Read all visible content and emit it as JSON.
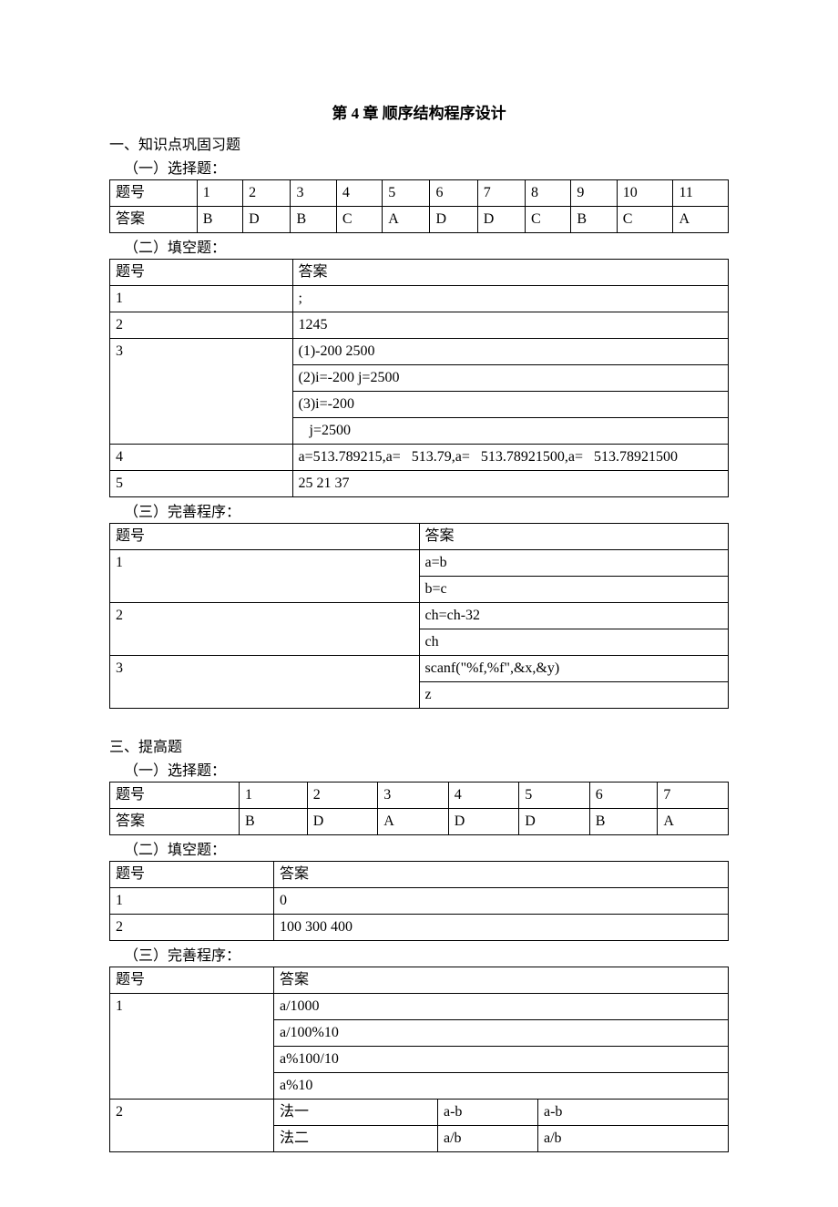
{
  "page_title": "第 4 章  顺序结构程序设计",
  "section1": {
    "heading": "一、知识点巩固习题",
    "sub1": {
      "heading": "（一）选择题：",
      "table": {
        "row_label_1": "题号",
        "row_label_2": "答案",
        "headers": [
          "1",
          "2",
          "3",
          "4",
          "5",
          "6",
          "7",
          "8",
          "9",
          "10",
          "11"
        ],
        "answers": [
          "B",
          "D",
          "B",
          "C",
          "A",
          "D",
          "D",
          "C",
          "B",
          "C",
          "A"
        ]
      }
    },
    "sub2": {
      "heading": "（二）填空题：",
      "table": {
        "h1": "题号",
        "h2": "答案",
        "rows": [
          {
            "num": "1",
            "lines": [
              ";"
            ]
          },
          {
            "num": "2",
            "lines": [
              "1245"
            ]
          },
          {
            "num": "3",
            "lines": [
              "(1)-200 2500",
              "(2)i=-200 j=2500",
              "(3)i=-200",
              "   j=2500"
            ]
          },
          {
            "num": "4",
            "lines": [
              "a=513.789215,a=   513.79,a=   513.78921500,a=   513.78921500"
            ]
          },
          {
            "num": "5",
            "lines": [
              "25 21 37"
            ]
          }
        ]
      }
    },
    "sub3": {
      "heading": "（三）完善程序：",
      "table": {
        "h1": "题号",
        "h2": "答案",
        "rows": [
          {
            "num": "1",
            "lines": [
              "a=b",
              "b=c"
            ]
          },
          {
            "num": "2",
            "lines": [
              "ch=ch-32",
              "ch"
            ]
          },
          {
            "num": "3",
            "lines": [
              "scanf(\"%f,%f\",&x,&y)",
              "z"
            ]
          }
        ]
      }
    }
  },
  "section3": {
    "heading": "三、提高题",
    "sub1": {
      "heading": "（一）选择题：",
      "table": {
        "row_label_1": "题号",
        "row_label_2": "答案",
        "headers": [
          "1",
          "2",
          "3",
          "4",
          "5",
          "6",
          "7"
        ],
        "answers": [
          "B",
          "D",
          "A",
          "D",
          "D",
          "B",
          "A"
        ]
      }
    },
    "sub2": {
      "heading": "（二）填空题：",
      "table": {
        "h1": "题号",
        "h2": "答案",
        "rows": [
          {
            "num": "1",
            "lines": [
              "0"
            ]
          },
          {
            "num": "2",
            "lines": [
              "100 300 400"
            ]
          }
        ]
      }
    },
    "sub3": {
      "heading": "（三）完善程序：",
      "table": {
        "h1": "题号",
        "h2": "答案",
        "rows": [
          {
            "num": "1",
            "type": "single",
            "lines": [
              "a/1000",
              "a/100%10",
              "a%100/10",
              "a%10"
            ]
          },
          {
            "num": "2",
            "type": "split",
            "lines": [
              {
                "m": "法一",
                "a": "a-b",
                "b": "a-b"
              },
              {
                "m": "法二",
                "a": "a/b",
                "b": "a/b"
              }
            ]
          }
        ]
      }
    }
  }
}
